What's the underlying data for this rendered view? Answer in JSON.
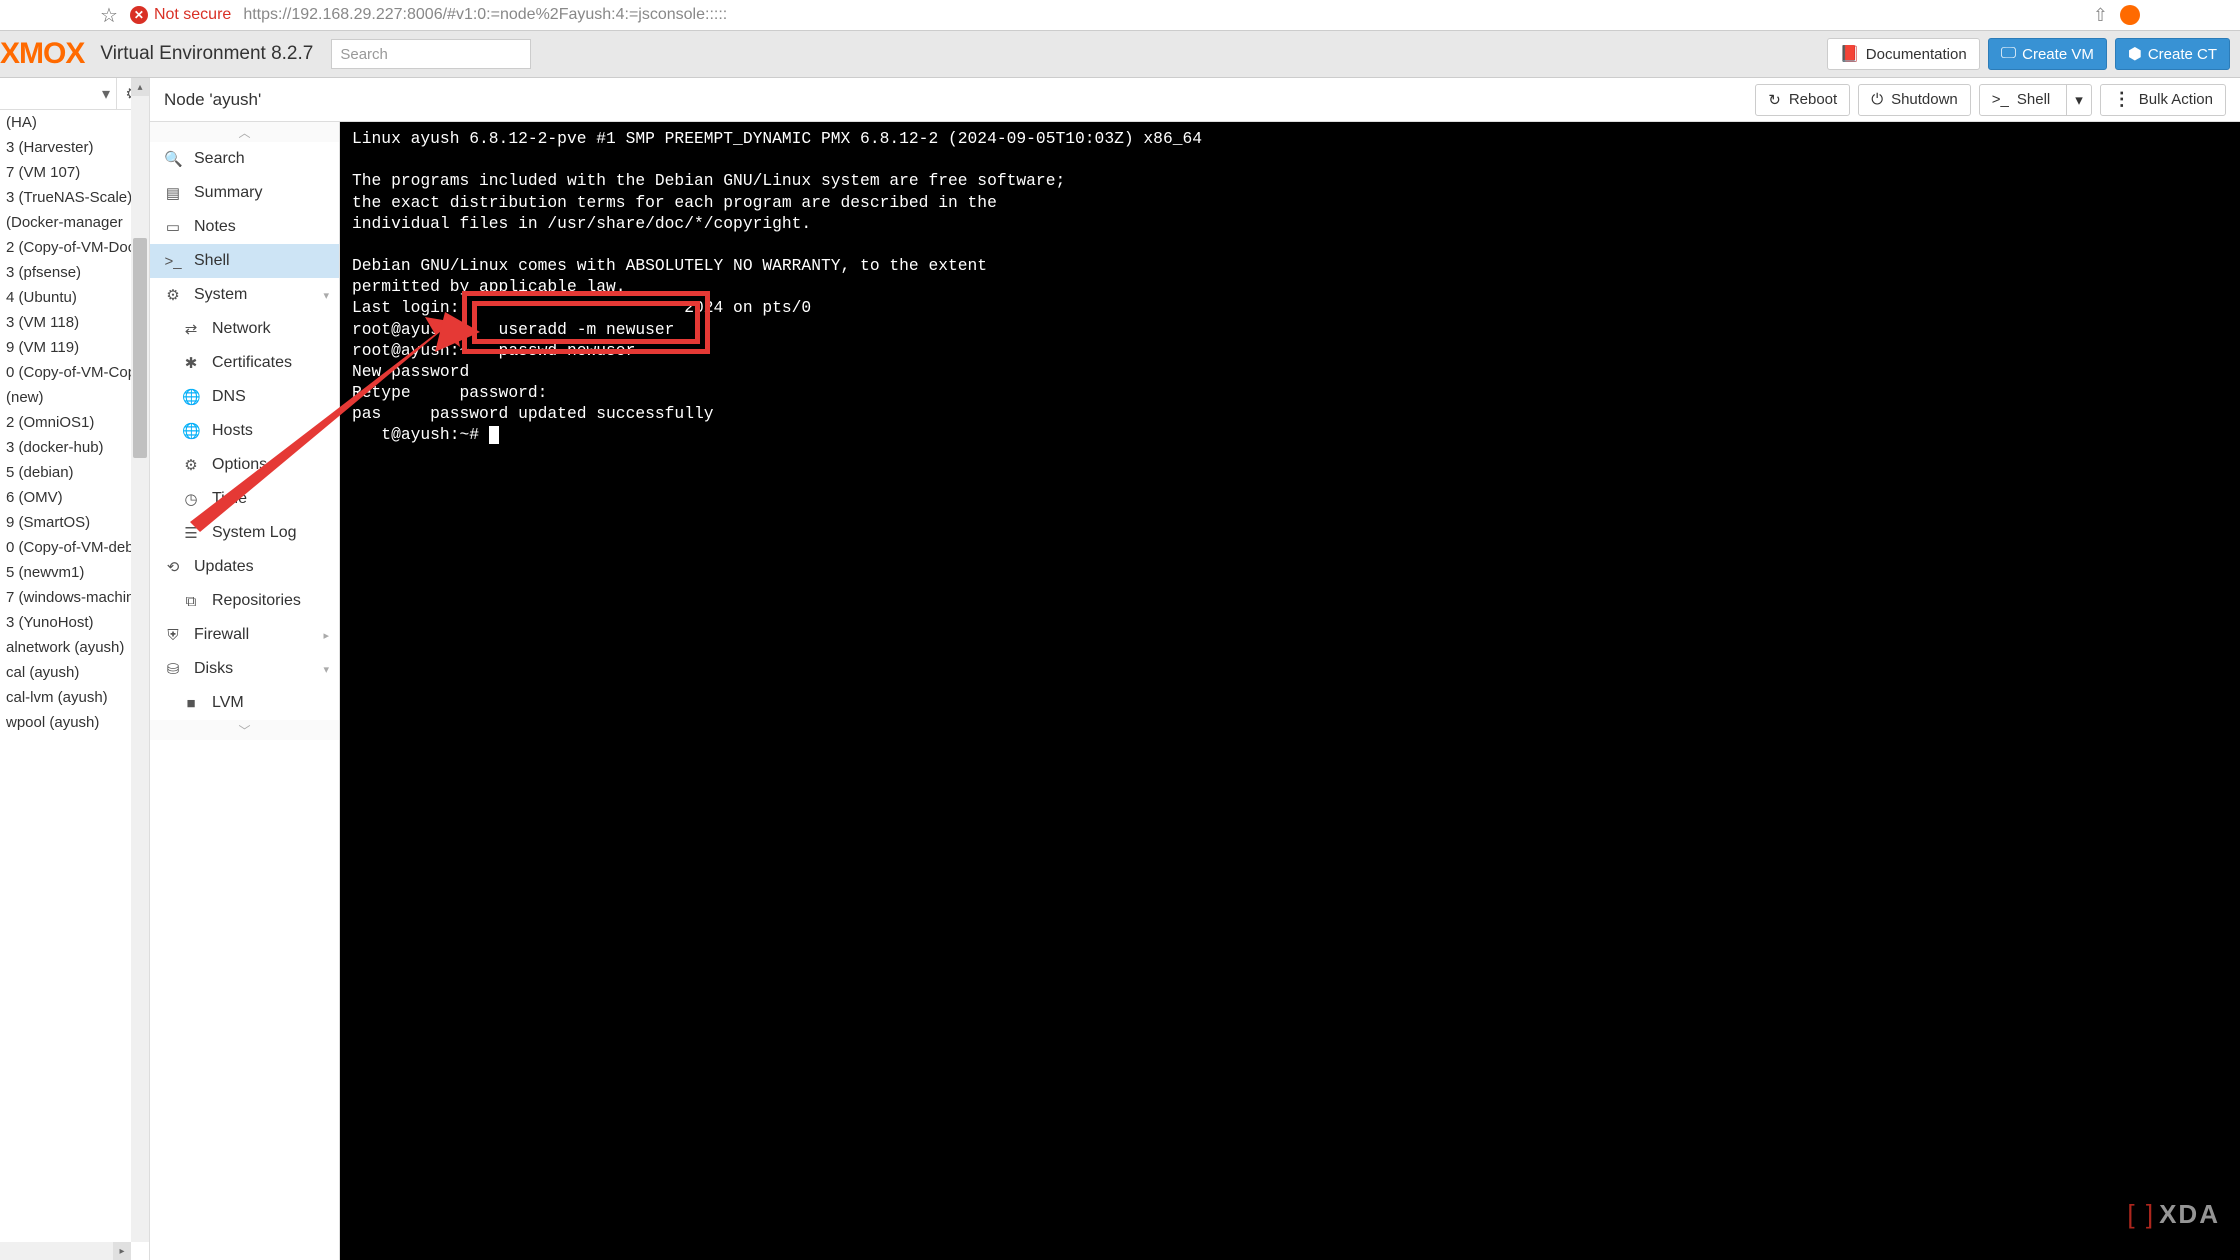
{
  "browser": {
    "not_secure": "Not secure",
    "url": "https://192.168.29.227:8006/#v1:0:=node%2Fayush:4:=jsconsole:::::"
  },
  "header": {
    "logo_suffix": "XMOX",
    "ve_label": "Virtual Environment 8.2.7",
    "search_placeholder": "Search",
    "doc_btn": "Documentation",
    "create_vm_btn": "Create VM",
    "create_ct_btn": "Create CT"
  },
  "tree": {
    "items": [
      " (HA)",
      "3 (Harvester)",
      "7 (VM 107)",
      "3 (TrueNAS-Scale)",
      " (Docker-manager",
      "2 (Copy-of-VM-Doc",
      "3 (pfsense)",
      "4 (Ubuntu)",
      "3 (VM 118)",
      "9 (VM 119)",
      "0 (Copy-of-VM-Cop",
      "  (new)",
      "2 (OmniOS1)",
      "3 (docker-hub)",
      "5 (debian)",
      "6 (OMV)",
      "9 (SmartOS)",
      "0 (Copy-of-VM-deb",
      "5 (newvm1)",
      "7 (windows-machin",
      "3 (YunoHost)",
      "alnetwork (ayush)",
      "cal (ayush)",
      "cal-lvm (ayush)",
      "wpool (ayush)"
    ]
  },
  "content": {
    "node_title": "Node 'ayush'",
    "reboot_btn": "Reboot",
    "shutdown_btn": "Shutdown",
    "shell_btn": "Shell",
    "bulk_btn": "Bulk Action"
  },
  "nav": {
    "search": "Search",
    "summary": "Summary",
    "notes": "Notes",
    "shell": "Shell",
    "system": "System",
    "network": "Network",
    "certificates": "Certificates",
    "dns": "DNS",
    "hosts": "Hosts",
    "options": "Options",
    "time": "Time",
    "syslog": "System Log",
    "updates": "Updates",
    "repositories": "Repositories",
    "firewall": "Firewall",
    "disks": "Disks",
    "lvm": "LVM"
  },
  "terminal": {
    "line1": "Linux ayush 6.8.12-2-pve #1 SMP PREEMPT_DYNAMIC PMX 6.8.12-2 (2024-09-05T10:03Z) x86_64",
    "line2": "",
    "line3": "The programs included with the Debian GNU/Linux system are free software;",
    "line4": "the exact distribution terms for each program are described in the",
    "line5": "individual files in /usr/share/doc/*/copyright.",
    "line6": "",
    "line7": "Debian GNU/Linux comes with ABSOLUTELY NO WARRANTY, to the extent",
    "line8": "permitted by applicable law.",
    "line9": "Last login:                       2024 on pts/0",
    "line10": "root@ayush:~   useradd -m newuser",
    "line11": "root@ayush:~   passwd newuser",
    "line12": "New password",
    "line13": "Retype     password:",
    "line14": "pas     password updated successfully",
    "line15": "   t@ayush:~# "
  },
  "watermark": "XDA"
}
